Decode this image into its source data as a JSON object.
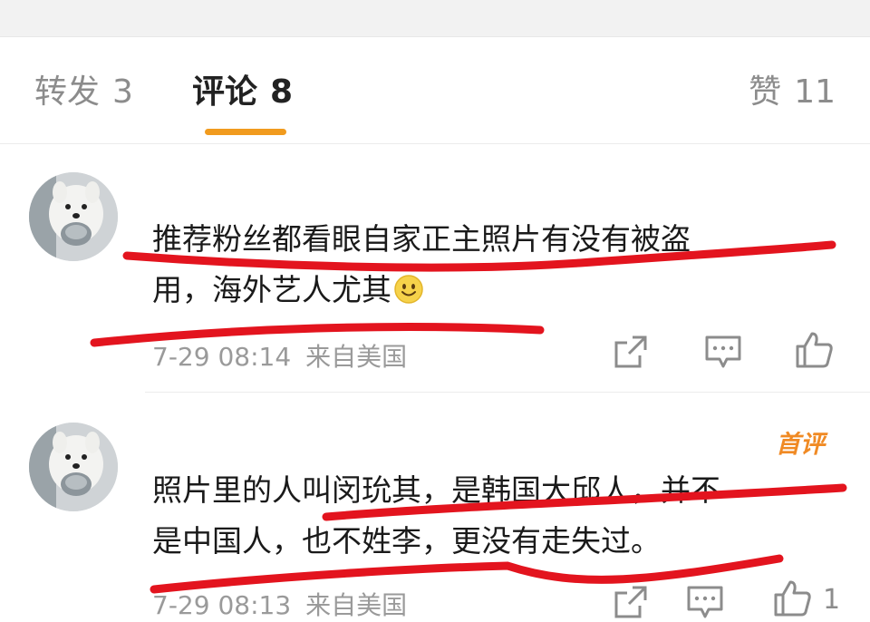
{
  "tabs": [
    {
      "label": "转发",
      "count": "3"
    },
    {
      "label": "评论",
      "count": "8"
    },
    {
      "label": "赞",
      "count": "11"
    }
  ],
  "comments": [
    {
      "line1": "推荐粉丝都看眼自家正主照片有没有被盗",
      "line2": "用，海外艺人尤其",
      "emoji_icon": "smile-emoji-icon",
      "time": "7-29 08:14",
      "source": "来自美国",
      "badge": "",
      "like_count": ""
    },
    {
      "line1": "照片里的人叫闵玧其，是韩国大邱人，并不",
      "line2": "是中国人，也不姓李，更没有走失过。",
      "time": "7-29 08:13",
      "source": "来自美国",
      "badge": "首评",
      "like_count": "1"
    }
  ],
  "icons": [
    "share-icon",
    "comment-icon",
    "like-icon"
  ],
  "colors": {
    "accent": "#f19b1e",
    "badge": "#f08a24",
    "annotation": "#e3141e"
  }
}
